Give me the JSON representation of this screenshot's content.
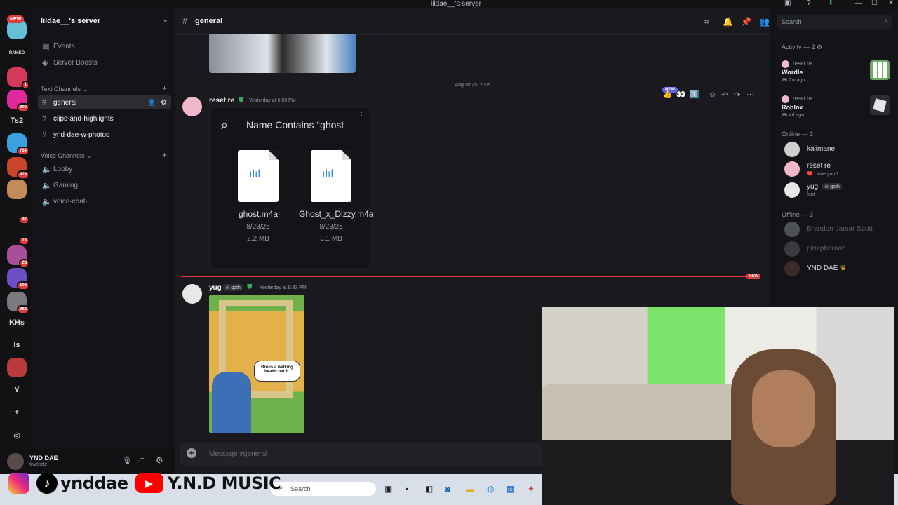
{
  "window": {
    "title": "lildae__'s server"
  },
  "guilds": [
    {
      "label": "",
      "badge": "",
      "color": "#63c0d6"
    },
    {
      "label": "RAMEO",
      "badge": "",
      "color": "#121214"
    },
    {
      "label": "",
      "badge": "1",
      "color": "#d63a5a"
    },
    {
      "label": "",
      "badge": "890",
      "color": "#e0299b"
    },
    {
      "label": "Ts2",
      "badge": "",
      "color": "#121214"
    },
    {
      "label": "",
      "badge": "769",
      "color": "#3aa0e0"
    },
    {
      "label": "",
      "badge": "429",
      "color": "#c9442a"
    },
    {
      "label": "",
      "badge": "",
      "color": "#c38b5a"
    },
    {
      "label": "",
      "badge": "47",
      "color": "#121214"
    },
    {
      "label": "",
      "badge": "13",
      "color": "#121214"
    },
    {
      "label": "",
      "badge": "28",
      "color": "#a84f9c"
    },
    {
      "label": "",
      "badge": "108",
      "color": "#6a4fc7"
    },
    {
      "label": "",
      "badge": "382",
      "color": "#787a7e"
    },
    {
      "label": "KHs",
      "badge": "",
      "color": "#121214"
    },
    {
      "label": "ls",
      "badge": "",
      "color": "#121214"
    },
    {
      "label": "",
      "badge": "",
      "color": "#b83a3a"
    },
    {
      "label": "Y",
      "badge": "",
      "color": "#121214"
    },
    {
      "label": "+",
      "badge": "",
      "color": "#121214"
    },
    {
      "label": "◎",
      "badge": "",
      "color": "#121214"
    }
  ],
  "guild_new_badge": "NEW",
  "sidebar": {
    "server_name": "lildae__'s server",
    "top_items": [
      {
        "label": "Events",
        "icon": "calendar-icon"
      },
      {
        "label": "Server Boosts",
        "icon": "boost-icon"
      }
    ],
    "text_category": "Text Channels",
    "text_channels": [
      "general",
      "clips-and-highlights",
      "ynd-dae-w-photos"
    ],
    "voice_category": "Voice Channels",
    "voice_channels": [
      "Lobby",
      "Gaming",
      "voice-chat-"
    ]
  },
  "user_panel": {
    "name": "YND DAE",
    "status": "Invisible"
  },
  "channel": {
    "name": "general"
  },
  "messages": {
    "date_divider": "August 25, 2025",
    "msg1": {
      "author": "reset re",
      "time": "Yesterday at 6:59 PM",
      "embed_title": "Name Contains “ghost",
      "files": [
        {
          "name": "ghost.m4a",
          "date": "8/23/25",
          "size": "2.2 MB"
        },
        {
          "name": "Ghost_x_Dizzy.m4a",
          "date": "8/23/25",
          "size": "3.1 MB"
        }
      ]
    },
    "new_label": "NEW",
    "msg2": {
      "author": "yug",
      "tag": "goth",
      "time": "Yesterday at 9:33 PM",
      "image_caption": "Bro is a walking health bar fr."
    }
  },
  "composer": {
    "placeholder": "Message #general"
  },
  "right_panel": {
    "search_placeholder": "Search",
    "activity_header": "Activity — 2",
    "activities": [
      {
        "user": "reset re",
        "game": "Wordle",
        "ago": "2w ago"
      },
      {
        "user": "reset re",
        "game": "Roblox",
        "ago": "4d ago"
      }
    ],
    "online_header": "Online — 3",
    "online": [
      {
        "name": "kalimane",
        "sub": ""
      },
      {
        "name": "reset re",
        "sub": "i love you!!"
      },
      {
        "name": "yug",
        "tag": "goth",
        "sub": "fent"
      }
    ],
    "offline_header": "Offline — 3",
    "offline": [
      {
        "name": "Brandon Jamar Scott"
      },
      {
        "name": "piruipharaoh"
      },
      {
        "name": "YND DAE"
      }
    ]
  },
  "overlay": {
    "handle": "ynddae",
    "channel": "Y.N.D MUSIC"
  },
  "taskbar": {
    "search_placeholder": "Search"
  }
}
